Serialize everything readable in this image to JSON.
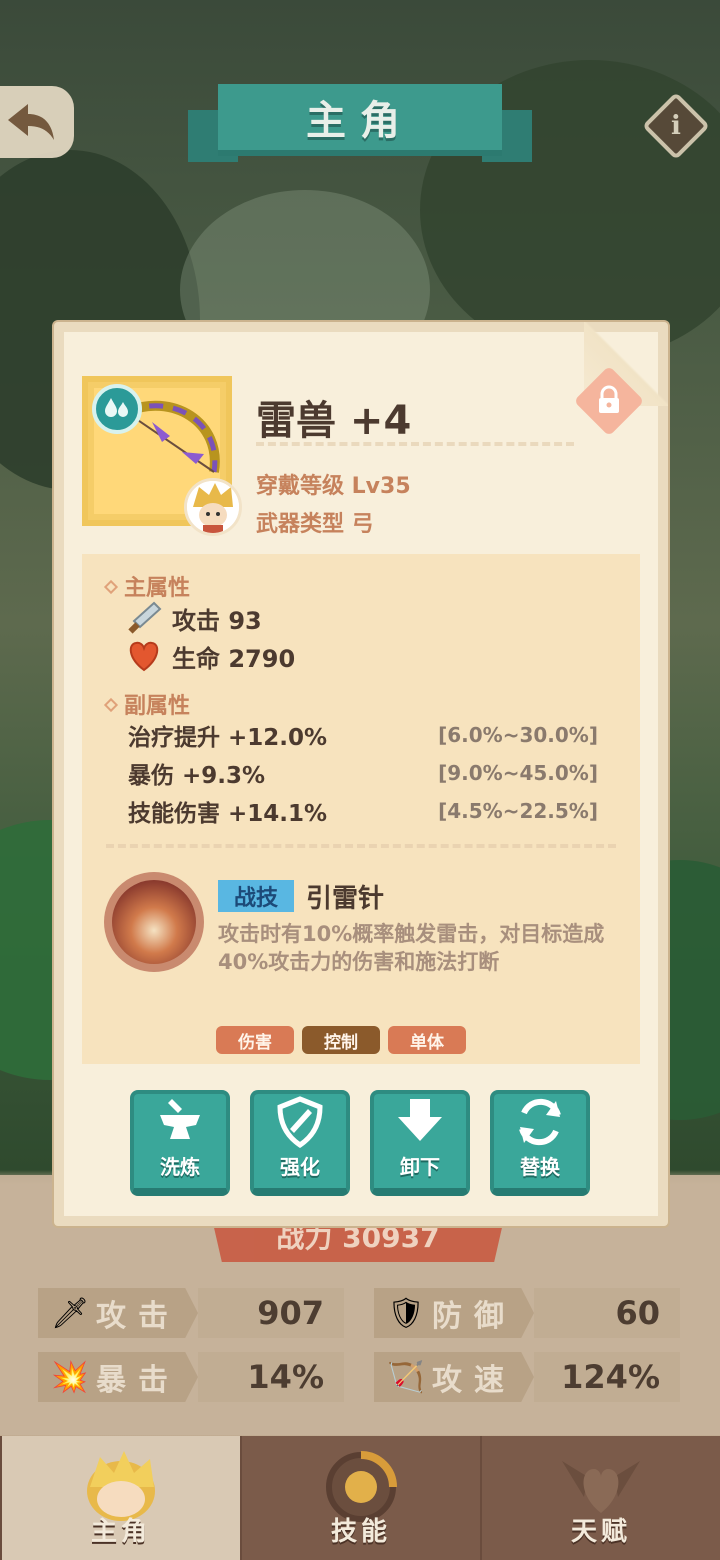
{
  "header": {
    "title": "主角"
  },
  "item": {
    "name": "雷兽 +4",
    "wear_level": "穿戴等级 Lv35",
    "weapon_type": "武器类型 弓",
    "main_attr_title": "主属性",
    "main_attrs": [
      {
        "label": "攻击 93",
        "icon": "sword-icon"
      },
      {
        "label": "生命 2790",
        "icon": "heart-icon"
      }
    ],
    "sub_attr_title": "副属性",
    "sub_attrs": [
      {
        "label": "治疗提升 +12.0%",
        "range": "[6.0%~30.0%]"
      },
      {
        "label": "暴伤 +9.3%",
        "range": "[9.0%~45.0%]"
      },
      {
        "label": "技能伤害 +14.1%",
        "range": "[4.5%~22.5%]"
      }
    ],
    "skill": {
      "tag": "战技",
      "name": "引雷针",
      "description": "攻击时有10%概率触发雷击，对目标造成40%攻击力的伤害和施法打断",
      "chips": [
        {
          "label": "伤害",
          "color": "#d97a55"
        },
        {
          "label": "控制",
          "color": "#8b5a2b"
        },
        {
          "label": "单体",
          "color": "#d97a55"
        }
      ]
    }
  },
  "actions": [
    {
      "label": "洗炼",
      "icon": "anvil-icon"
    },
    {
      "label": "强化",
      "icon": "shield-sword-icon"
    },
    {
      "label": "卸下",
      "icon": "arrow-down-icon"
    },
    {
      "label": "替换",
      "icon": "refresh-icon"
    }
  ],
  "power": "战力 30937",
  "stats": [
    {
      "label": "攻击",
      "value": "907",
      "icon": "sword-icon"
    },
    {
      "label": "防御",
      "value": "60",
      "icon": "shield-icon"
    },
    {
      "label": "暴击",
      "value": "14%",
      "icon": "crit-burst-icon"
    },
    {
      "label": "攻速",
      "value": "124%",
      "icon": "bow-icon"
    }
  ],
  "nav": [
    {
      "label": "主角",
      "active": true
    },
    {
      "label": "技能",
      "active": false
    },
    {
      "label": "天赋",
      "active": false
    }
  ],
  "colors": {
    "accent_teal": "#3aa79a",
    "text_dark": "#4c3a2f",
    "text_orange": "#c6825c",
    "panel_bg": "#f8efdb"
  }
}
